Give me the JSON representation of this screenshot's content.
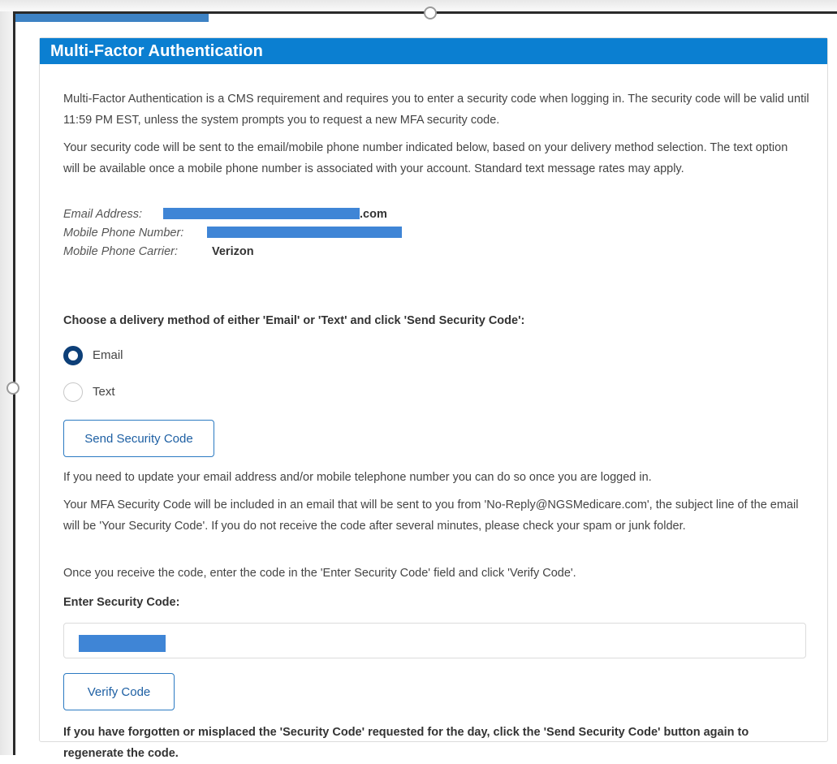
{
  "panel": {
    "title": "Multi-Factor Authentication"
  },
  "intro": {
    "paragraph1": "Multi-Factor Authentication is a CMS requirement and requires you to enter a security code when logging in. The security code will be valid until 11:59 PM EST, unless the system prompts you to request a new MFA security code.",
    "paragraph2": "Your security code will be sent to the email/mobile phone number indicated below, based on your delivery method selection. The text option will be available once a mobile phone number is associated with your account. Standard text message rates may apply."
  },
  "account": {
    "email_label": "Email Address:",
    "email_suffix": ".com",
    "phone_label": "Mobile Phone Number:",
    "carrier_label": "Mobile Phone Carrier:",
    "carrier_value": "Verizon"
  },
  "delivery": {
    "prompt": "Choose a delivery method of either 'Email' or 'Text' and click 'Send Security Code':",
    "options": [
      {
        "label": "Email",
        "selected": true
      },
      {
        "label": "Text",
        "selected": false
      }
    ],
    "send_button": "Send Security Code"
  },
  "notes": {
    "update_info": "If you need to update your email address and/or mobile telephone number you can do so once you are logged in.",
    "email_info": "Your MFA Security Code will be included in an email that will be sent to you from 'No-Reply@NGSMedicare.com', the subject line of the email will be 'Your Security Code'. If you do not receive the code after several minutes, please check your spam or junk folder.",
    "enter_info": "Once you receive the code, enter the code in the 'Enter Security Code' field and click 'Verify Code'."
  },
  "verify": {
    "label": "Enter Security Code:",
    "button": "Verify Code",
    "forgot_note": "If you have forgotten or misplaced the 'Security Code' requested for the day, click the 'Send Security Code' button again to regenerate the code."
  },
  "colors": {
    "header_bg": "#0b7fd1",
    "redaction": "#3f85d6",
    "radio_selected": "#0d3f78",
    "button_border": "#2b7ac2",
    "button_text": "#1d5fa3"
  }
}
